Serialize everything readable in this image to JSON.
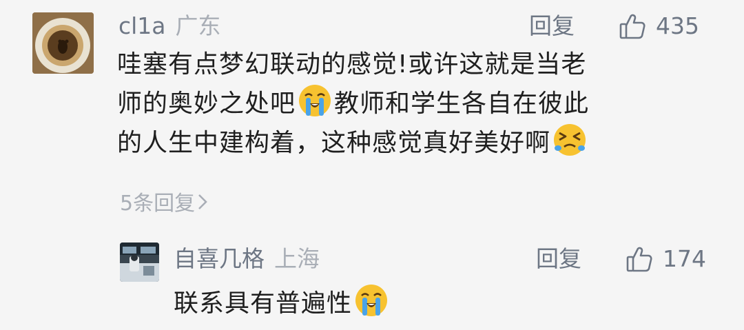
{
  "comment": {
    "author": "cl1a",
    "location": "广东",
    "reply_label": "回复",
    "likes": "435",
    "lines": [
      [
        "哇塞有点梦幻联动的感觉!或许这就是当老"
      ],
      [
        "师的奥妙之处吧",
        "教师和学生各自在彼此"
      ],
      [
        "的人生中建构着，这种感觉真好美好啊"
      ]
    ],
    "more_replies": "5条回复"
  },
  "reply": {
    "author": "自喜几格",
    "location": "上海",
    "reply_label": "回复",
    "likes": "174",
    "text": "联系具有普遍性"
  },
  "icons": {
    "like": "thumbs-up-icon",
    "emoji_cry": "loudly-crying-face-icon",
    "emoji_squint": "squinting-face-icon",
    "chevron": "chevron-right-icon"
  },
  "colors": {
    "background": "#f5f5f5",
    "text": "#1f1f1f",
    "name": "#6d7684",
    "muted": "#a9aeb6",
    "emoji": "#f7c230"
  }
}
